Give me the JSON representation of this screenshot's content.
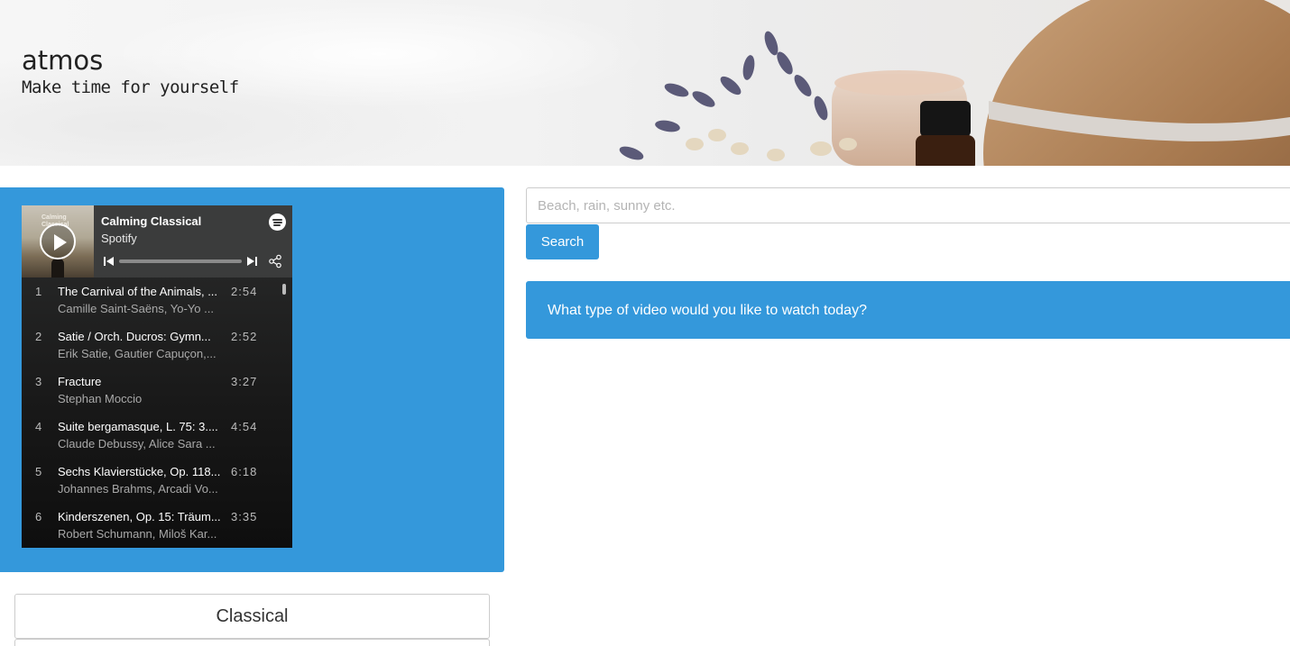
{
  "header": {
    "title": "atmos",
    "tagline": "Make time for yourself"
  },
  "player": {
    "cover_text": "Calming Classical",
    "playlist_title": "Calming Classical",
    "provider": "Spotify",
    "tracks": [
      {
        "num": "1",
        "name": "The Carnival of the Animals, ...",
        "artist": "Camille Saint-Saëns, Yo-Yo ...",
        "duration": "2:54"
      },
      {
        "num": "2",
        "name": "Satie / Orch. Ducros: Gymn...",
        "artist": "Erik Satie, Gautier Capuçon,...",
        "duration": "2:52"
      },
      {
        "num": "3",
        "name": "Fracture",
        "artist": "Stephan Moccio",
        "duration": "3:27"
      },
      {
        "num": "4",
        "name": "Suite bergamasque, L. 75: 3....",
        "artist": "Claude Debussy, Alice Sara ...",
        "duration": "4:54"
      },
      {
        "num": "5",
        "name": "Sechs Klavierstücke, Op. 118...",
        "artist": "Johannes Brahms, Arcadi Vo...",
        "duration": "6:18"
      },
      {
        "num": "6",
        "name": "Kinderszenen, Op. 15: Träum...",
        "artist": "Robert Schumann, Miloš Kar...",
        "duration": "3:35"
      }
    ]
  },
  "genres": [
    {
      "label": "Classical"
    }
  ],
  "search": {
    "placeholder": "Beach, rain, sunny etc.",
    "button_label": "Search"
  },
  "prompt": {
    "text": "What type of video would you like to watch today?"
  },
  "colors": {
    "accent": "#3498db",
    "player_bg": "#181818"
  }
}
